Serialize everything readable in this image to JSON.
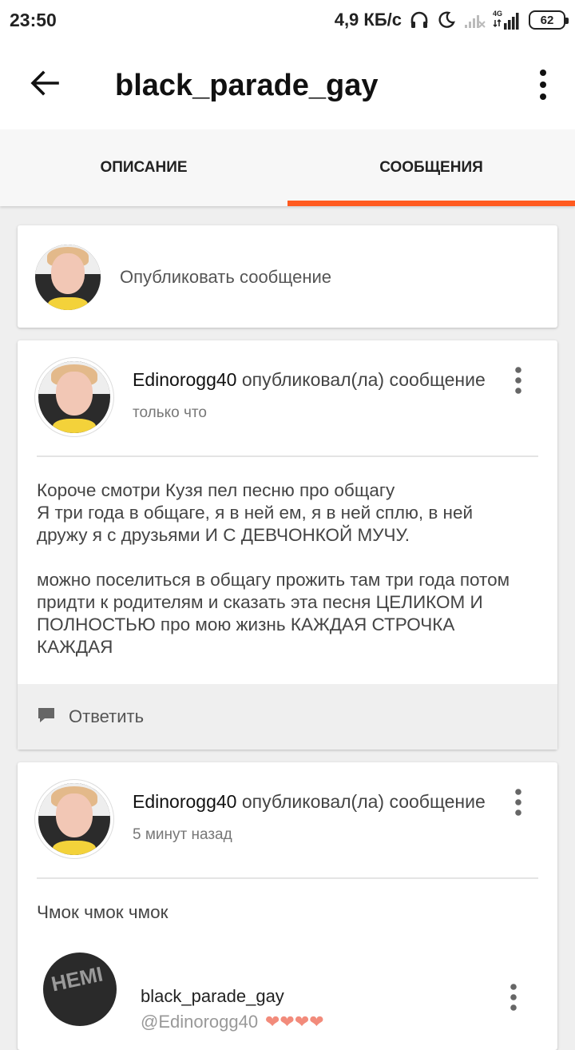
{
  "status_bar": {
    "time": "23:50",
    "net_speed": "4,9 КБ/с",
    "network": "4G",
    "battery": "62"
  },
  "app_bar": {
    "title": "black_parade_gay"
  },
  "tabs": [
    {
      "label": "ОПИСАНИЕ",
      "active": false
    },
    {
      "label": "СООБЩЕНИЯ",
      "active": true
    }
  ],
  "publish_box": {
    "placeholder": "Опубликовать сообщение"
  },
  "posts": [
    {
      "author": "Edinorogg40",
      "action": "опубликовал(ла) сообщение",
      "time": "только что",
      "body": "Короче смотри Кузя пел песню про общагу\nЯ три года в общаге, я в ней ем, я в ней сплю, в ней дружу я с друзьями И С ДЕВЧОНКОЙ МУЧУ.\n\nможно поселиться в общагу прожить там три года потом придти к родителям и сказать эта песня ЦЕЛИКОМ И ПОЛНОСТЬЮ про мою жизнь КАЖДАЯ СТРОЧКА КАЖДАЯ",
      "reply_label": "Ответить"
    },
    {
      "author": "Edinorogg40",
      "action": "опубликовал(ла) сообщение",
      "time": "5 минут назад",
      "body": "Чмок чмок чмок",
      "reply": {
        "name": "black_parade_gay",
        "mention": "@Edinorogg40",
        "hearts": "❤❤❤❤"
      }
    }
  ],
  "colors": {
    "accent": "#ff5a1f",
    "background": "#efefef"
  }
}
